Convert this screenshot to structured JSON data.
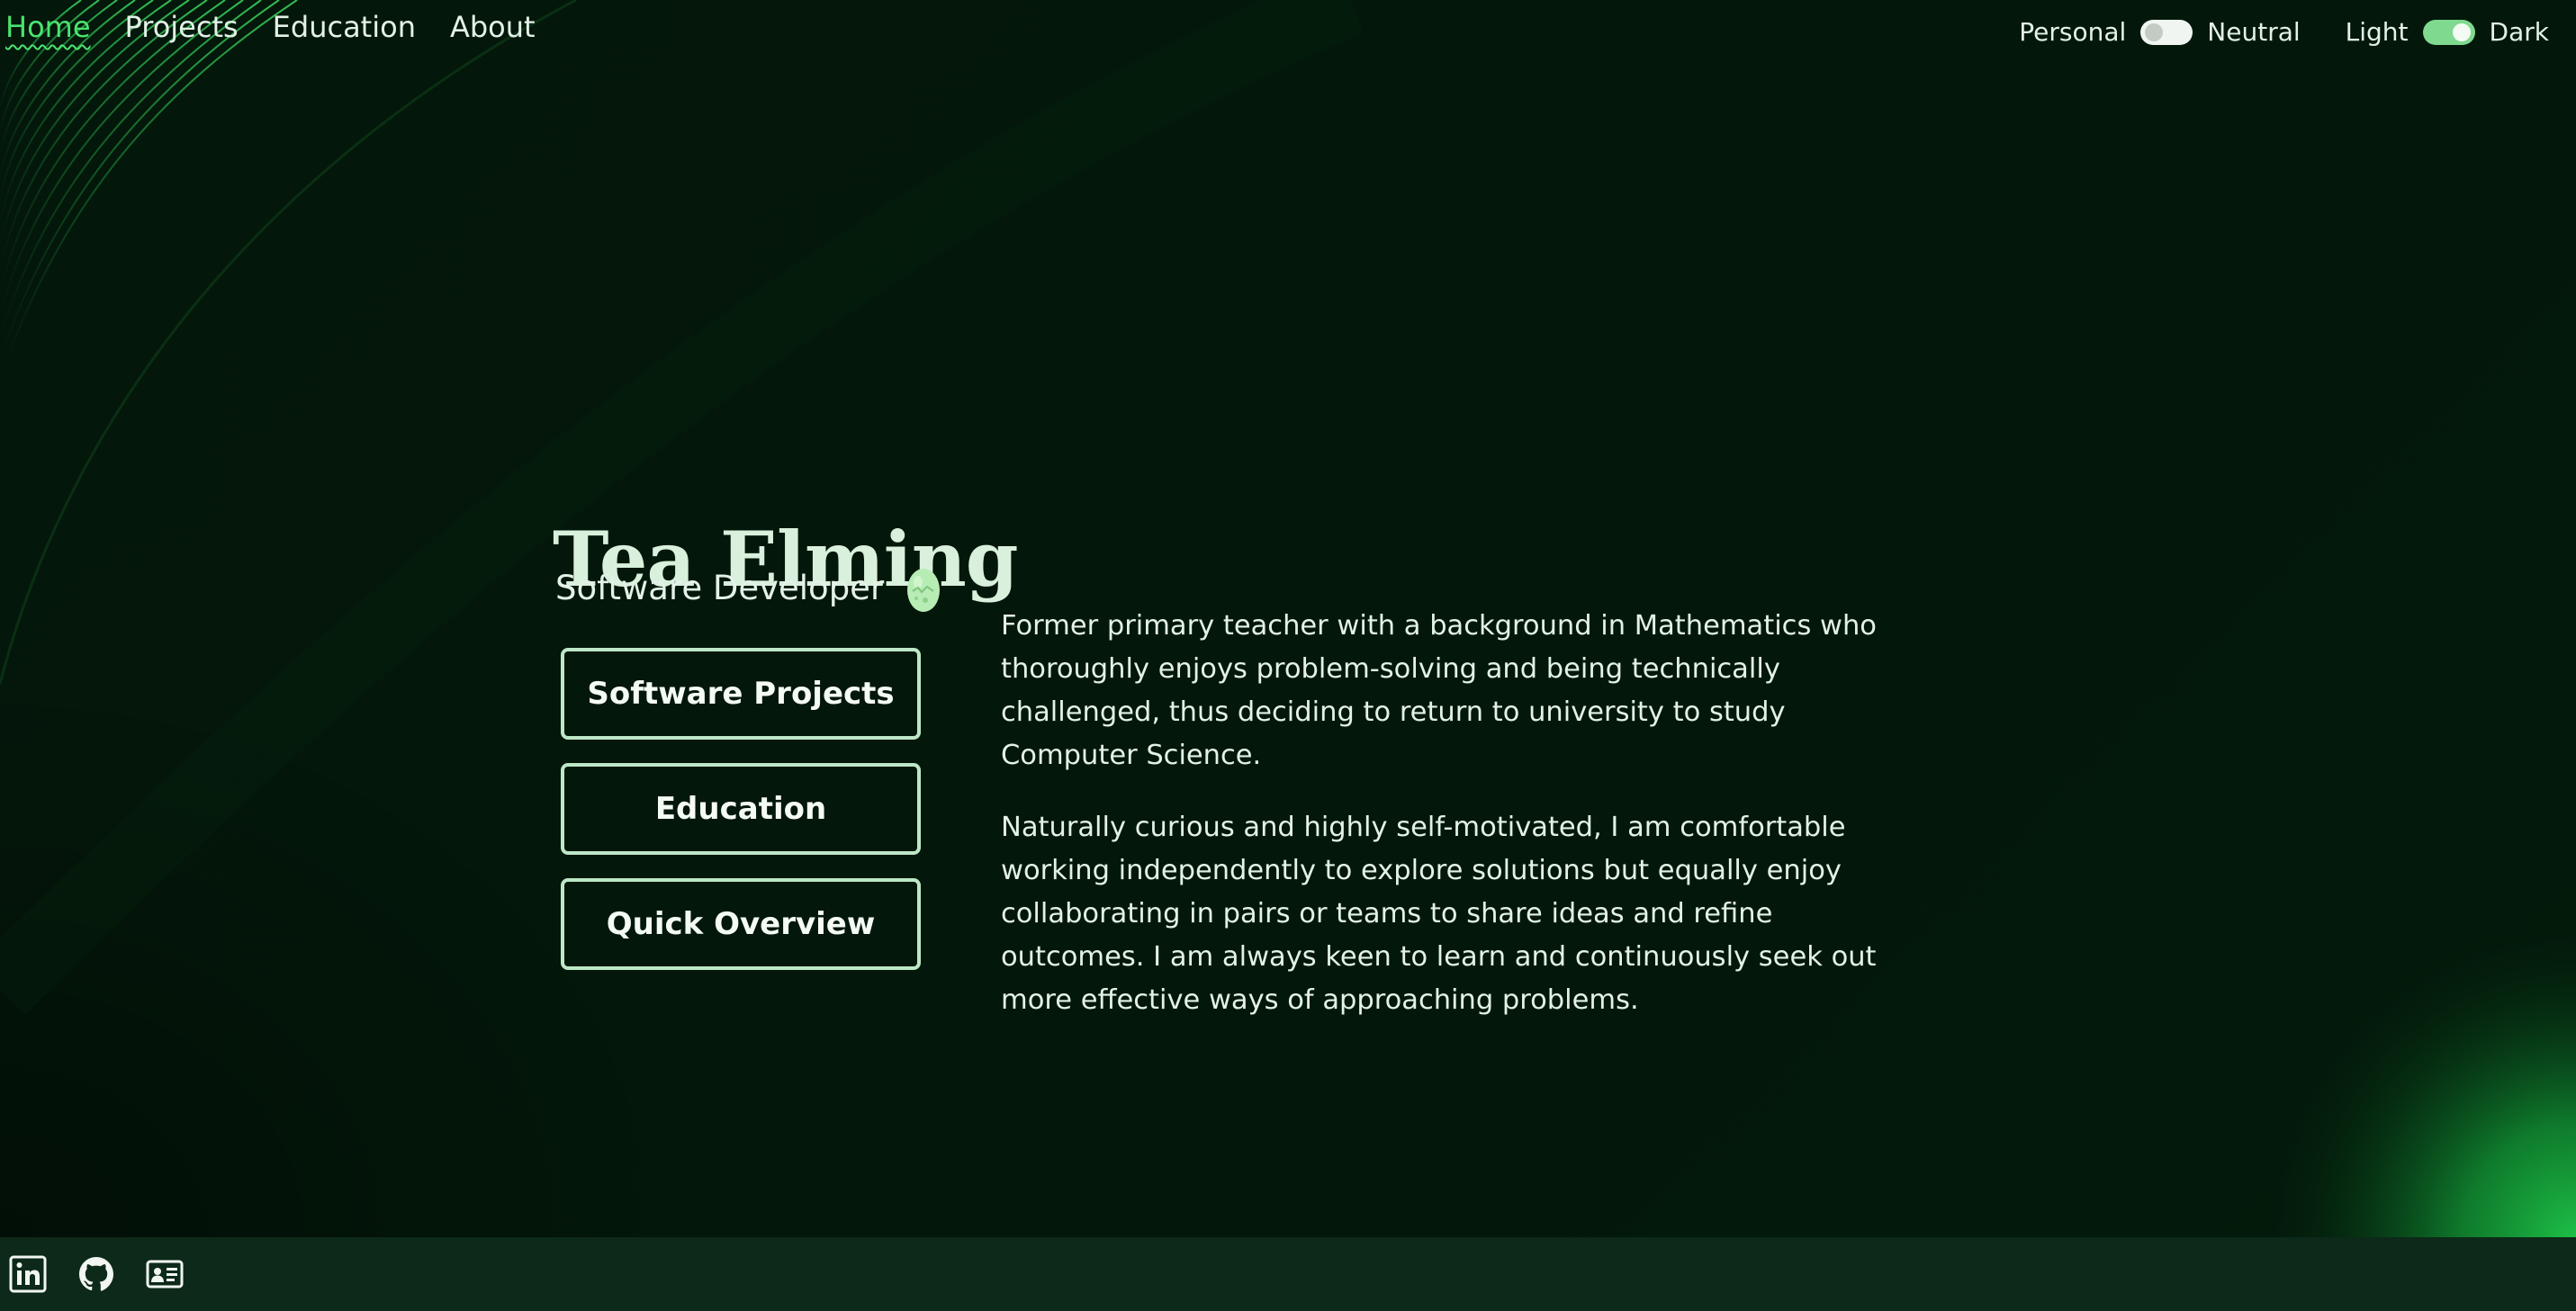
{
  "nav": {
    "items": [
      {
        "label": "Home",
        "active": true
      },
      {
        "label": "Projects",
        "active": false
      },
      {
        "label": "Education",
        "active": false
      },
      {
        "label": "About",
        "active": false
      }
    ]
  },
  "toggles": {
    "mode": {
      "left_label": "Personal",
      "right_label": "Neutral",
      "on": false
    },
    "theme": {
      "left_label": "Light",
      "right_label": "Dark",
      "on": true
    }
  },
  "hero": {
    "name": "Tea Elming",
    "role": "Software Developer",
    "role_icon": "egg-icon",
    "buttons": [
      "Software Projects",
      "Education",
      "Quick Overview"
    ]
  },
  "bio": {
    "paragraphs": [
      "Former primary teacher with a background in Mathematics who thoroughly enjoys problem-solving and being technically challenged, thus deciding to return to university to study Computer Science.",
      "Naturally curious and highly self-motivated, I am comfortable working independently to explore solutions but equally enjoy collaborating in pairs or teams to share ideas and refine outcomes. I am always keen to learn and continuously seek out more effective ways of approaching problems."
    ]
  },
  "footer": {
    "icons": [
      "linkedin-icon",
      "github-icon",
      "contact-card-icon"
    ]
  },
  "colors": {
    "background": "#03160a",
    "accent": "#4be36f",
    "footer": "#0d2919",
    "button_border": "#bde8c7"
  }
}
